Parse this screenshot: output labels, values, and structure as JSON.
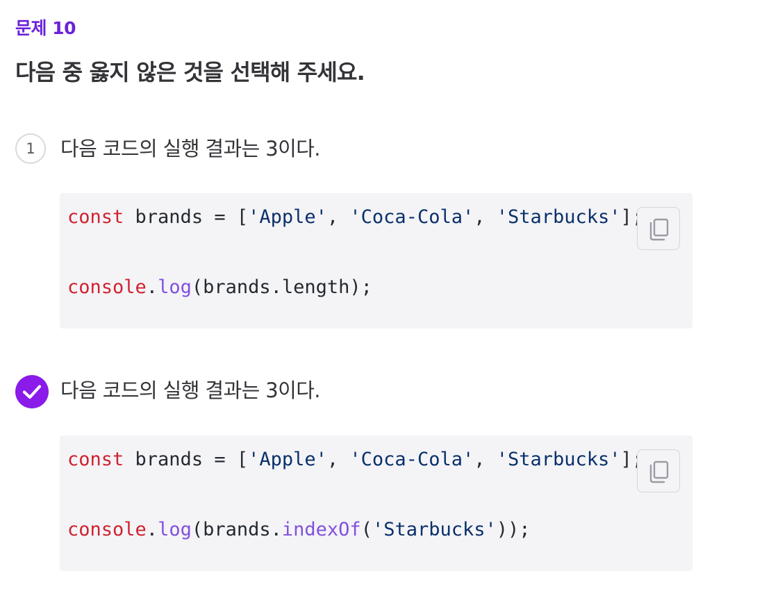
{
  "question": {
    "label": "문제 10",
    "title": "다음 중 옳지 않은 것을 선택해 주세요."
  },
  "options": [
    {
      "number": "1",
      "selected": false,
      "text": "다음 코드의 실행 결과는 3이다.",
      "code": {
        "line1": {
          "keyword": "const",
          "decl": " brands = [",
          "s1": "'Apple'",
          "sep1": ", ",
          "s2": "'Coca-Cola'",
          "sep2": ", ",
          "s3": "'Starbucks'",
          "end": "];"
        },
        "line2": {
          "obj": "console",
          "dot": ".",
          "fn": "log",
          "rest": "(brands.length);"
        }
      },
      "copy_icon": "copy-icon"
    },
    {
      "number": "",
      "selected": true,
      "text": "다음 코드의 실행 결과는 3이다.",
      "code": {
        "line1": {
          "keyword": "const",
          "decl": " brands = [",
          "s1": "'Apple'",
          "sep1": ", ",
          "s2": "'Coca-Cola'",
          "sep2": ", ",
          "s3": "'Starbucks'",
          "end": "];"
        },
        "line2": {
          "obj": "console",
          "dot": ".",
          "fn": "log",
          "open": "(brands.",
          "fn2": "indexOf",
          "paren": "(",
          "arg": "'Starbucks'",
          "close": "));"
        }
      },
      "copy_icon": "copy-icon"
    }
  ],
  "colors": {
    "accent": "#8a1be9",
    "label": "#6b21d9",
    "code_bg": "#f4f4f7",
    "keyword": "#cf222e",
    "string": "#0a3069",
    "function": "#8250df"
  },
  "icons": {
    "selected": "check-circle-icon",
    "copy": "copy-icon"
  }
}
